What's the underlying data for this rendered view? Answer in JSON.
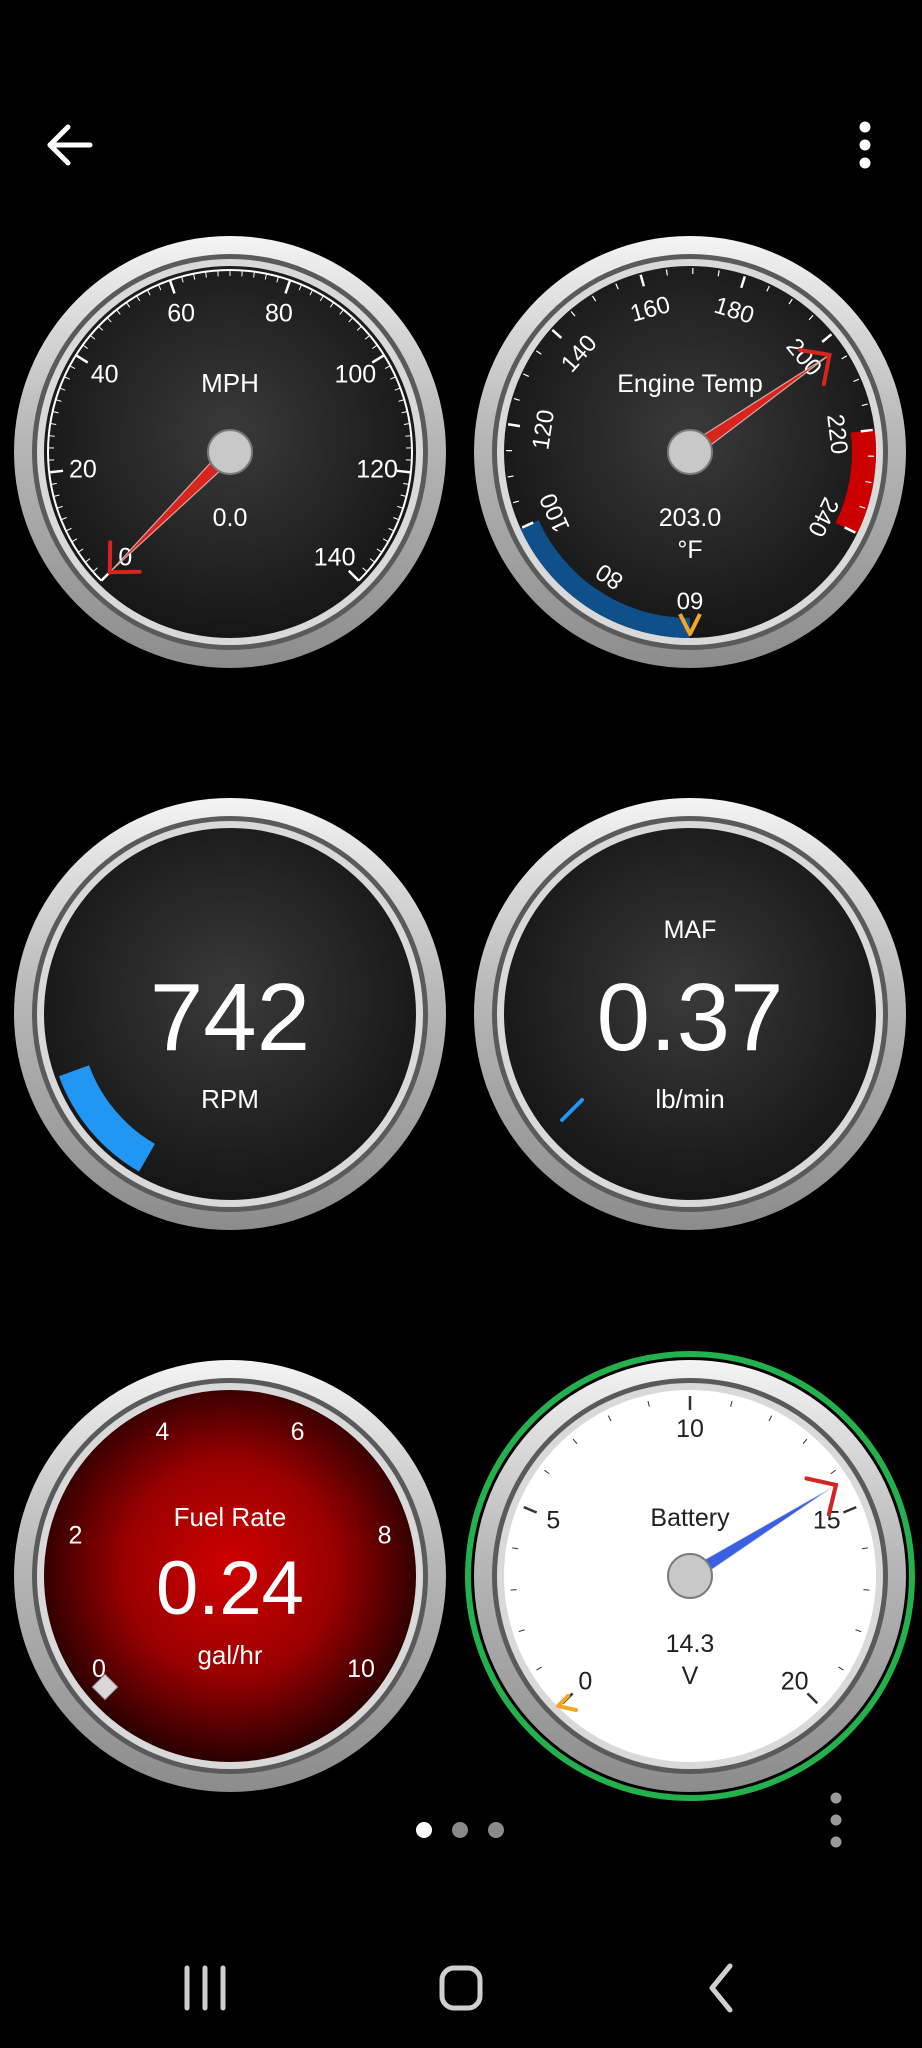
{
  "header": {
    "back_icon": "arrow-left-icon",
    "menu_icon": "more-vert-icon"
  },
  "gauges": {
    "speed": {
      "title": "MPH",
      "value": "0.0",
      "ticks": [
        "0",
        "20",
        "40",
        "60",
        "80",
        "100",
        "120",
        "140"
      ],
      "needle_value": 0,
      "range": [
        0,
        140
      ]
    },
    "engine_temp": {
      "title": "Engine Temp",
      "value": "203.0",
      "unit": "°F",
      "ticks": [
        "60",
        "80",
        "100",
        "120",
        "140",
        "160",
        "180",
        "200",
        "220",
        "240"
      ],
      "needle_value": 203,
      "range": [
        60,
        240
      ],
      "cold_band": [
        60,
        100
      ],
      "hot_band": [
        220,
        240
      ],
      "cold_color": "#0f4f8a",
      "hot_color": "#cc0000"
    },
    "rpm": {
      "title": "RPM",
      "value": "742",
      "bar_color": "#2196f3"
    },
    "maf": {
      "title": "MAF",
      "value": "0.37",
      "unit": "lb/min",
      "bar_color": "#2196f3"
    },
    "fuel_rate": {
      "title": "Fuel Rate",
      "value": "0.24",
      "unit": "gal/hr",
      "ticks": [
        "0",
        "2",
        "4",
        "6",
        "8",
        "10"
      ],
      "range": [
        0,
        10
      ],
      "face_color": "#cc0000"
    },
    "battery": {
      "title": "Battery",
      "value": "14.3",
      "unit": "V",
      "ticks": [
        "0",
        "5",
        "10",
        "15",
        "20"
      ],
      "needle_value": 14.3,
      "range": [
        0,
        20
      ],
      "ring_color": "#22b14c",
      "needle_color": "#3a5fe0"
    }
  },
  "pager": {
    "pages": 3,
    "active": 0,
    "more_icon": "more-vert-icon"
  },
  "navbar": {
    "recents_icon": "recent-apps-icon",
    "home_icon": "home-icon",
    "back_icon": "back-chevron-icon"
  },
  "colors": {
    "needle_red": "#d9231d",
    "warning_orange": "#f5a623"
  }
}
